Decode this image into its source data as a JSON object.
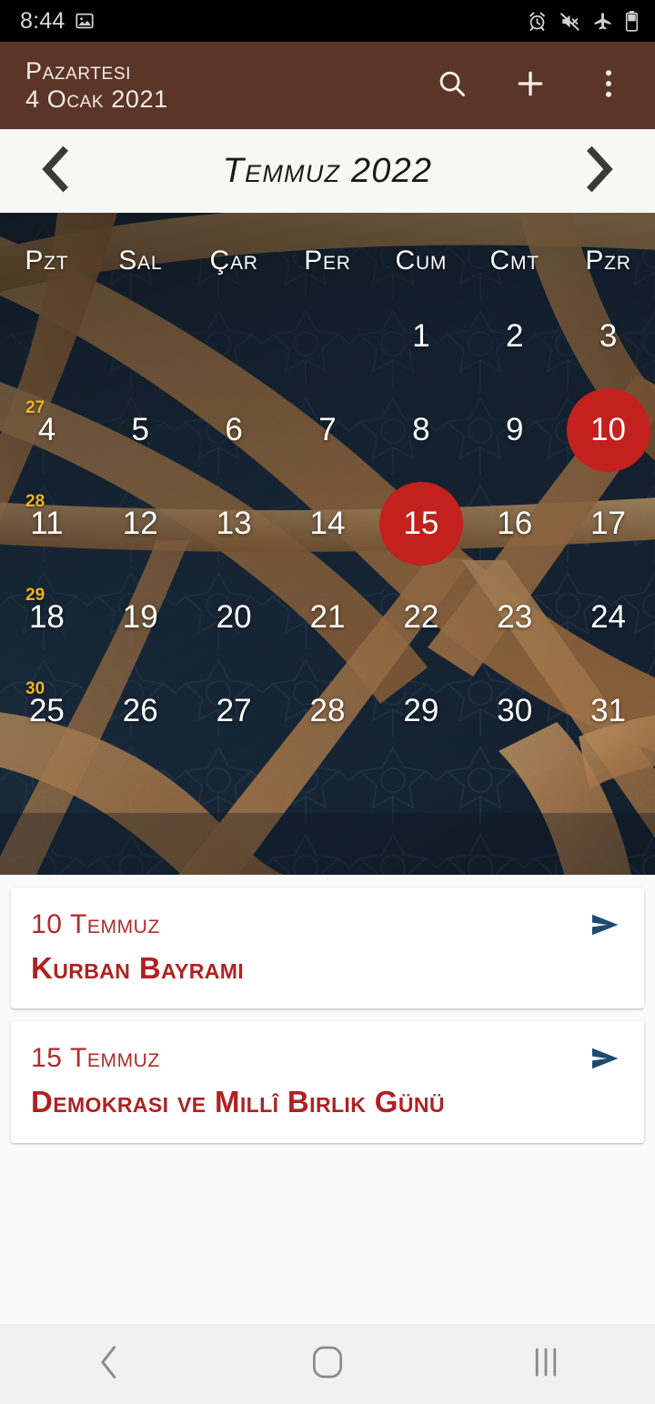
{
  "status_bar": {
    "time": "8:44",
    "left_icons": [
      "image-icon"
    ],
    "right_icons": [
      "alarm-icon",
      "mute-icon",
      "airplane-icon",
      "battery-icon"
    ]
  },
  "app_bar": {
    "weekday": "Pazartesi",
    "date": "4 Ocak 2021",
    "background_color": "#5b3527",
    "actions": [
      {
        "name": "search-button",
        "icon": "search-icon"
      },
      {
        "name": "add-button",
        "icon": "plus-icon"
      },
      {
        "name": "overflow-menu-button",
        "icon": "more-vertical-icon"
      }
    ]
  },
  "month_nav": {
    "prev_icon": "chevron-left-icon",
    "title": "Temmuz 2022",
    "next_icon": "chevron-right-icon"
  },
  "calendar": {
    "day_headers": [
      "Pzt",
      "Sal",
      "Çar",
      "Per",
      "Cum",
      "Cmt",
      "Pzr"
    ],
    "highlight_color": "#c4201e",
    "week_number_color": "#f0b323",
    "weeks": [
      {
        "week_number": "",
        "days": [
          {
            "label": "",
            "empty": true
          },
          {
            "label": "",
            "empty": true
          },
          {
            "label": "",
            "empty": true
          },
          {
            "label": "",
            "empty": true
          },
          {
            "label": "1",
            "selected": false
          },
          {
            "label": "2",
            "selected": false
          },
          {
            "label": "3",
            "selected": false
          }
        ]
      },
      {
        "week_number": "27",
        "days": [
          {
            "label": "4",
            "selected": false
          },
          {
            "label": "5",
            "selected": false
          },
          {
            "label": "6",
            "selected": false
          },
          {
            "label": "7",
            "selected": false
          },
          {
            "label": "8",
            "selected": false
          },
          {
            "label": "9",
            "selected": false
          },
          {
            "label": "10",
            "selected": true
          }
        ]
      },
      {
        "week_number": "28",
        "days": [
          {
            "label": "11",
            "selected": false
          },
          {
            "label": "12",
            "selected": false
          },
          {
            "label": "13",
            "selected": false
          },
          {
            "label": "14",
            "selected": false
          },
          {
            "label": "15",
            "selected": true
          },
          {
            "label": "16",
            "selected": false
          },
          {
            "label": "17",
            "selected": false
          }
        ]
      },
      {
        "week_number": "29",
        "days": [
          {
            "label": "18",
            "selected": false
          },
          {
            "label": "19",
            "selected": false
          },
          {
            "label": "20",
            "selected": false
          },
          {
            "label": "21",
            "selected": false
          },
          {
            "label": "22",
            "selected": false
          },
          {
            "label": "23",
            "selected": false
          },
          {
            "label": "24",
            "selected": false
          }
        ]
      },
      {
        "week_number": "30",
        "days": [
          {
            "label": "25",
            "selected": false
          },
          {
            "label": "26",
            "selected": false
          },
          {
            "label": "27",
            "selected": false
          },
          {
            "label": "28",
            "selected": false
          },
          {
            "label": "29",
            "selected": false
          },
          {
            "label": "30",
            "selected": false
          },
          {
            "label": "31",
            "selected": false
          }
        ]
      }
    ]
  },
  "events": [
    {
      "date": "10 Temmuz",
      "title": "Kurban Bayramı",
      "arrow_icon": "send-arrow-icon"
    },
    {
      "date": "15 Temmuz",
      "title": "Demokrasi ve Millî Birlik Günü",
      "arrow_icon": "send-arrow-icon"
    }
  ],
  "nav_bar": {
    "buttons": [
      {
        "name": "nav-back-button",
        "icon": "chevron-left-icon"
      },
      {
        "name": "nav-home-button",
        "icon": "home-square-icon"
      },
      {
        "name": "nav-recents-button",
        "icon": "recents-bars-icon"
      }
    ]
  }
}
